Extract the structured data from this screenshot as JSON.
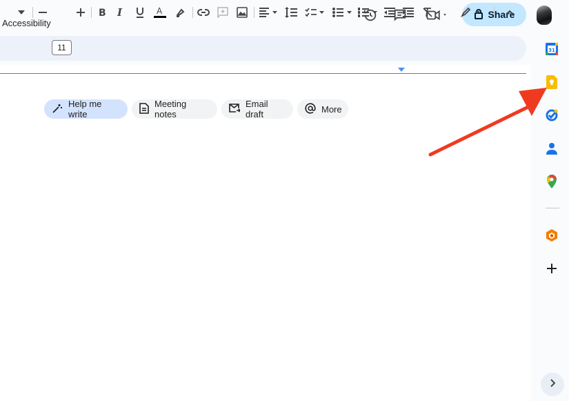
{
  "menu": {
    "accessibility": "Accessibility"
  },
  "header": {
    "share_label": "Share"
  },
  "toolbar": {
    "font_size": "11"
  },
  "chips": [
    {
      "label": "Help me write",
      "icon": "pen-sparkle-icon"
    },
    {
      "label": "Meeting notes",
      "icon": "document-icon"
    },
    {
      "label": "Email draft",
      "icon": "email-draft-icon"
    },
    {
      "label": "More",
      "icon": "at-sign-icon"
    }
  ],
  "side_panel": {
    "calendar_date": "31",
    "apps": [
      "calendar",
      "keep",
      "tasks",
      "contacts",
      "maps",
      "office-addon",
      "add"
    ]
  },
  "colors": {
    "share_bg": "#c2e7ff",
    "toolbar_bg": "#edf2fa",
    "active_chip": "#d3e3fd",
    "annotation_arrow": "#f03a1f"
  }
}
